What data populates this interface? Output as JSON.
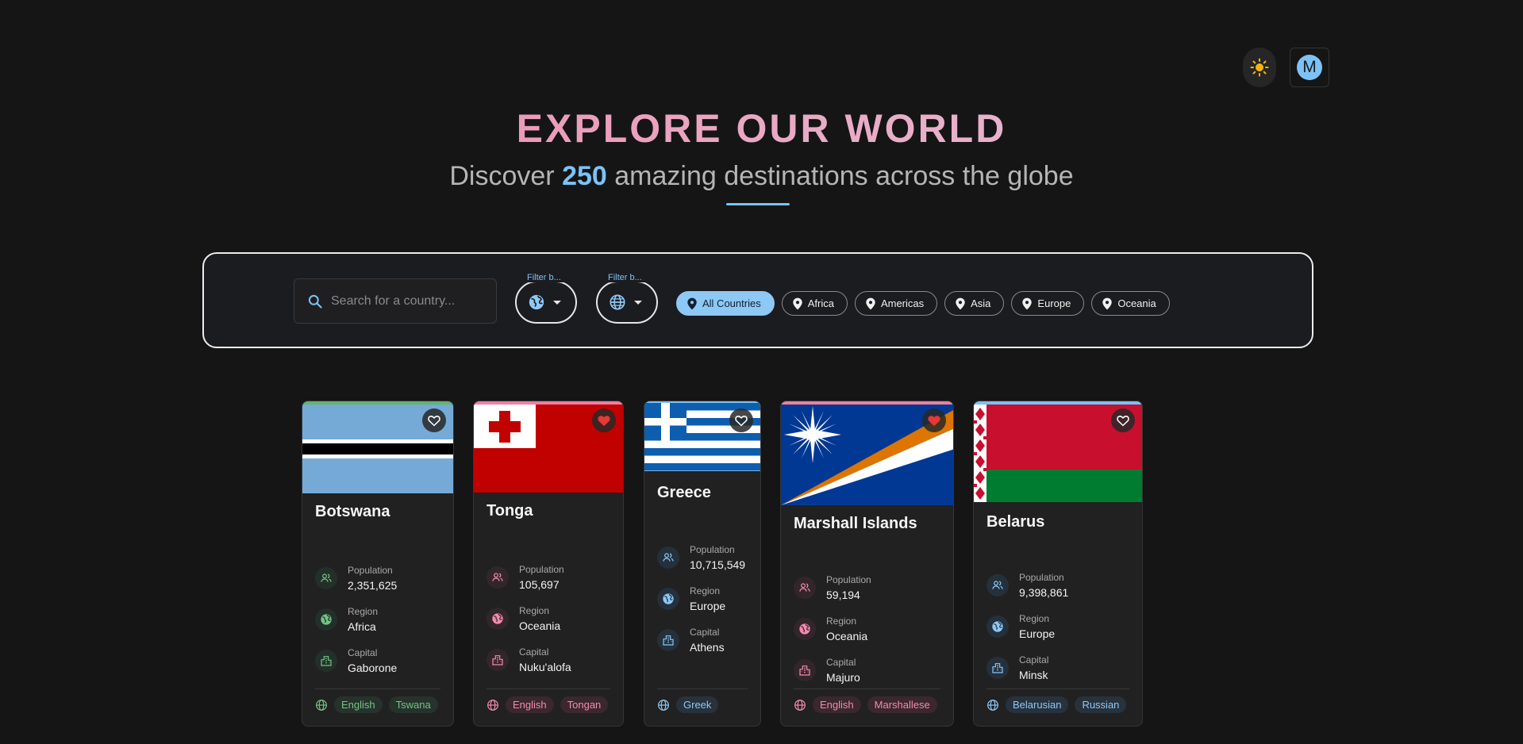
{
  "header": {
    "theme_icon": "sun-icon",
    "avatar_initial": "M"
  },
  "hero": {
    "title": "EXPLORE OUR WORLD",
    "subtitle_prefix": "Discover ",
    "count": "250",
    "subtitle_suffix": " amazing destinations across the globe"
  },
  "filters": {
    "search_placeholder": "Search for a country...",
    "search_value": "",
    "filter1_label": "Filter b...",
    "filter2_label": "Filter b...",
    "chips": [
      "All Countries",
      "Africa",
      "Americas",
      "Asia",
      "Europe",
      "Oceania"
    ],
    "active_chip": "All Countries"
  },
  "labels": {
    "population": "Population",
    "region": "Region",
    "capital": "Capital"
  },
  "colors": {
    "accent_blue": "#7cc2f7",
    "accent_pink": "#f07fa0",
    "accent_green": "#75c383",
    "favorite_red": "#e53935"
  },
  "countries": [
    {
      "name": "Botswana",
      "population": "2,351,625",
      "region": "Africa",
      "capital": "Gaborone",
      "languages": [
        "English",
        "Tswana"
      ],
      "favorite": false,
      "theme": "green"
    },
    {
      "name": "Tonga",
      "population": "105,697",
      "region": "Oceania",
      "capital": "Nuku'alofa",
      "languages": [
        "English",
        "Tongan"
      ],
      "favorite": true,
      "theme": "pink"
    },
    {
      "name": "Greece",
      "population": "10,715,549",
      "region": "Europe",
      "capital": "Athens",
      "languages": [
        "Greek"
      ],
      "favorite": false,
      "theme": "blue"
    },
    {
      "name": "Marshall Islands",
      "population": "59,194",
      "region": "Oceania",
      "capital": "Majuro",
      "languages": [
        "English",
        "Marshallese"
      ],
      "favorite": true,
      "theme": "pink"
    },
    {
      "name": "Belarus",
      "population": "9,398,861",
      "region": "Europe",
      "capital": "Minsk",
      "languages": [
        "Belarusian",
        "Russian"
      ],
      "favorite": false,
      "theme": "blue"
    }
  ]
}
